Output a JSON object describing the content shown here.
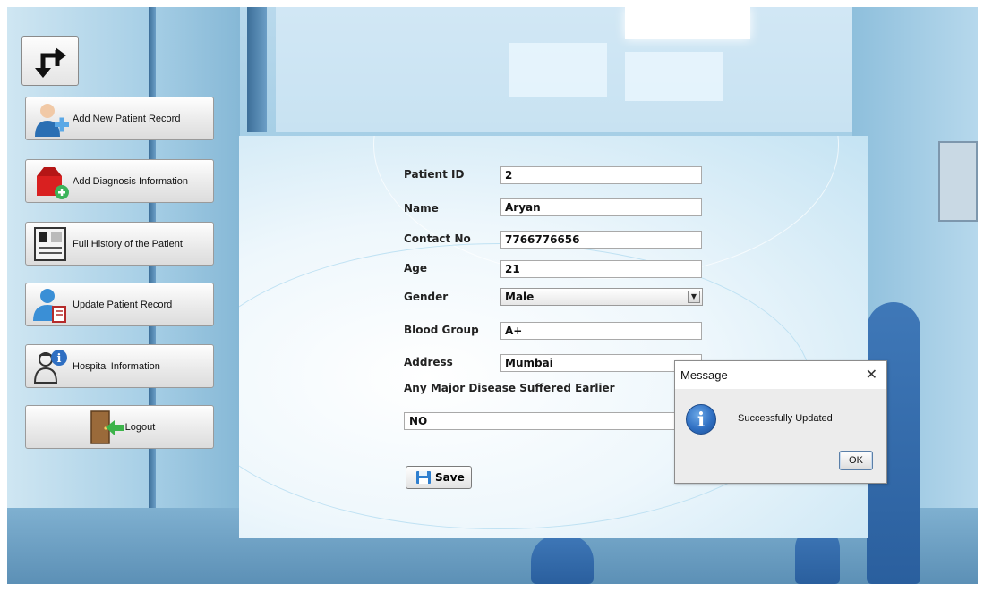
{
  "nav": {
    "top_icon": "transfer-arrows-icon",
    "items": [
      {
        "label": "Add New Patient Record",
        "icon": "doctor-add-icon"
      },
      {
        "label": "Add Diagnosis Information",
        "icon": "medical-kit-add-icon"
      },
      {
        "label": "Full History of the Patient",
        "icon": "patient-file-icon"
      },
      {
        "label": "Update Patient Record",
        "icon": "patient-update-icon"
      },
      {
        "label": "Hospital Information",
        "icon": "nurse-info-icon"
      },
      {
        "label": "Logout",
        "icon": "exit-door-icon"
      }
    ]
  },
  "form": {
    "patient_id": {
      "label": "Patient ID",
      "value": "2"
    },
    "name": {
      "label": "Name",
      "value": "Aryan"
    },
    "contact_no": {
      "label": "Contact No",
      "value": "7766776656"
    },
    "age": {
      "label": "Age",
      "value": "21"
    },
    "gender": {
      "label": "Gender",
      "value": "Male"
    },
    "blood_group": {
      "label": "Blood Group",
      "value": "A+"
    },
    "address": {
      "label": "Address",
      "value": "Mumbai"
    },
    "major_disease": {
      "label": "Any Major Disease Suffered Earlier",
      "value": "NO"
    },
    "save_label": "Save"
  },
  "dialog": {
    "title": "Message",
    "close": "✕",
    "icon_letter": "i",
    "message": "Successfully Updated",
    "ok_label": "OK"
  },
  "colors": {
    "dialog_icon": "#2f6fc2",
    "panel_background": "#eef7fc",
    "nav_button": "#ececec"
  }
}
